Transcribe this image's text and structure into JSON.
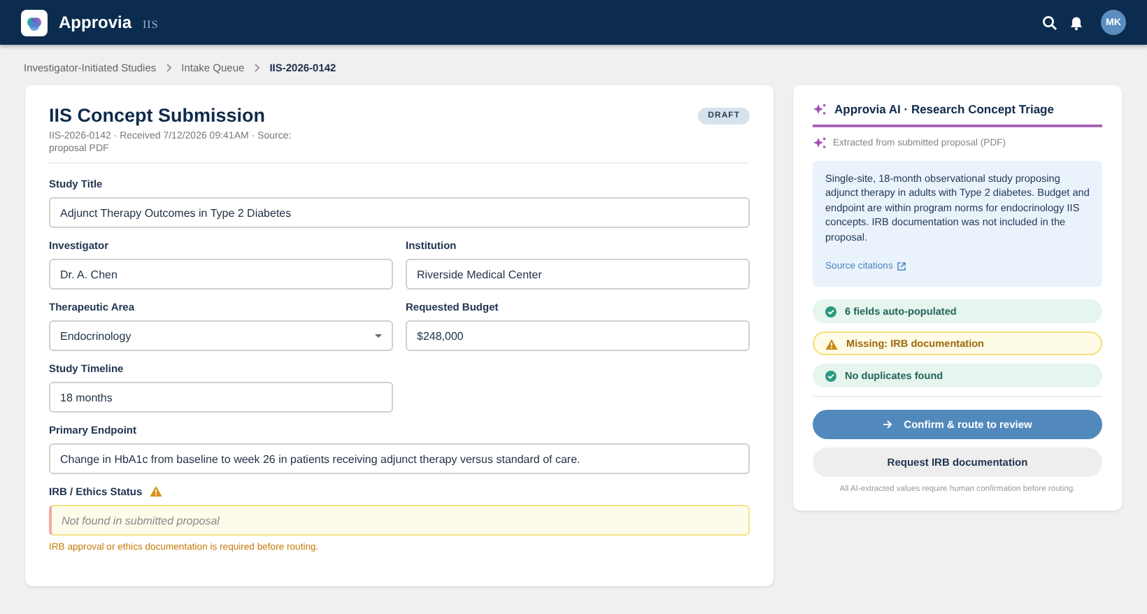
{
  "header": {
    "brand": "Approvia",
    "product": "IIS",
    "avatar": "MK"
  },
  "breadcrumb": [
    {
      "label": "Investigator-Initiated Studies",
      "current": false
    },
    {
      "label": "Intake Queue",
      "current": false
    },
    {
      "label": "IIS-2026-0142",
      "current": true
    }
  ],
  "form": {
    "title": "IIS Concept Submission",
    "meta": "IIS-2026-0142 · Received 7/12/2026 09:41AM · Source: proposal PDF",
    "badge": "DRAFT",
    "rows": [
      {
        "fields": [
          {
            "kind": "text",
            "label": "Study Title",
            "value": "Adjunct Therapy Outcomes in Type 2 Diabetes"
          }
        ]
      },
      {
        "fields": [
          {
            "kind": "text",
            "label": "Investigator",
            "value": "Dr. A. Chen"
          },
          {
            "kind": "text",
            "label": "Institution",
            "value": "Riverside Medical Center"
          }
        ]
      },
      {
        "fields": [
          {
            "kind": "select",
            "label": "Therapeutic Area",
            "value": "Endocrinology"
          },
          {
            "kind": "text",
            "label": "Requested Budget",
            "value": "$248,000"
          }
        ]
      },
      {
        "fields": [
          {
            "kind": "text",
            "label": "Study Timeline",
            "value": "18 months"
          },
          {
            "kind": "blank"
          }
        ]
      },
      {
        "fields": [
          {
            "kind": "text",
            "label": "Primary Endpoint",
            "value": "Change in HbA1c from baseline to week 26 in patients receiving adjunct therapy versus standard of care."
          }
        ]
      },
      {
        "fields": [
          {
            "kind": "missing",
            "label": "IRB / Ethics Status",
            "placeholder": "Not found in submitted proposal",
            "error": "IRB approval or ethics documentation is required before routing."
          }
        ]
      }
    ]
  },
  "ai_panel": {
    "title": "Approvia AI · Research Concept Triage",
    "source": "Extracted from submitted proposal (PDF)",
    "summary": "Single-site, 18-month observational study proposing adjunct therapy in adults with Type 2 diabetes. Budget and endpoint are within program norms for endocrinology IIS concepts. IRB documentation was not included in the proposal.",
    "link": "Source citations",
    "statuses": [
      {
        "kind": "ok",
        "label": "6 fields auto-populated"
      },
      {
        "kind": "warn",
        "label": "Missing: IRB documentation"
      },
      {
        "kind": "ok",
        "label": "No duplicates found"
      }
    ],
    "buttons": [
      {
        "kind": "primary",
        "label": "Confirm & route to review"
      },
      {
        "kind": "secondary",
        "label": "Request IRB documentation"
      }
    ],
    "footnote": "All AI-extracted values require human confirmation before routing."
  }
}
